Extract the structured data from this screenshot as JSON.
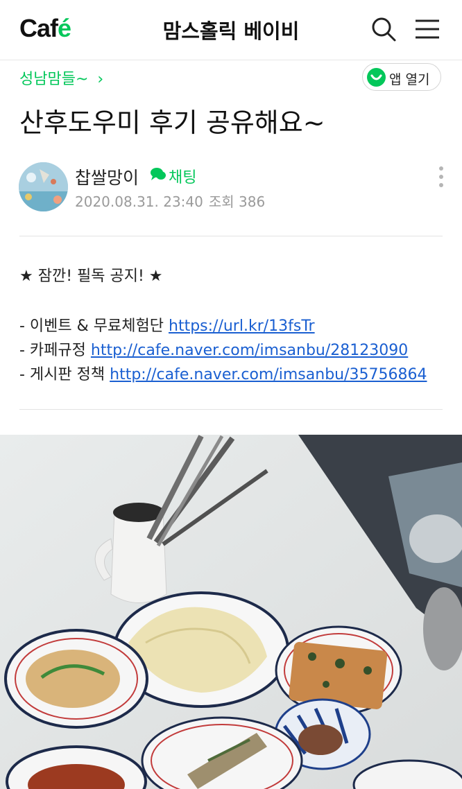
{
  "header": {
    "logo_main": "Caf",
    "logo_accent": "é",
    "cafe_name": "맘스홀릭 베이비",
    "search_icon": "search-icon",
    "menu_icon": "hamburger-menu-icon"
  },
  "board": {
    "name": "성남맘들~",
    "chevron": "›"
  },
  "app_button": {
    "label": "앱 열기",
    "icon": "naver-cafe-app-icon"
  },
  "post": {
    "title": "산후도우미 후기 공유해요~",
    "author": "찹쌀망이",
    "chat_label": "채팅",
    "date": "2020.08.31. 23:40",
    "views_label": "조회 386"
  },
  "notice": {
    "heading": "★ 잠깐! 필독 공지! ★",
    "items": [
      {
        "label": "- 이벤트 & 무료체험단 ",
        "link": "https://url.kr/13fsTr"
      },
      {
        "label": "- 카페규정 ",
        "link": "http://cafe.naver.com/imsanbu/28123090"
      },
      {
        "label": "- 게시판 정책 ",
        "link": "http://cafe.naver.com/imsanbu/35756864"
      }
    ]
  },
  "colors": {
    "accent": "#03c75a",
    "link": "#1a5fd1",
    "meta": "#9a9a9a"
  }
}
